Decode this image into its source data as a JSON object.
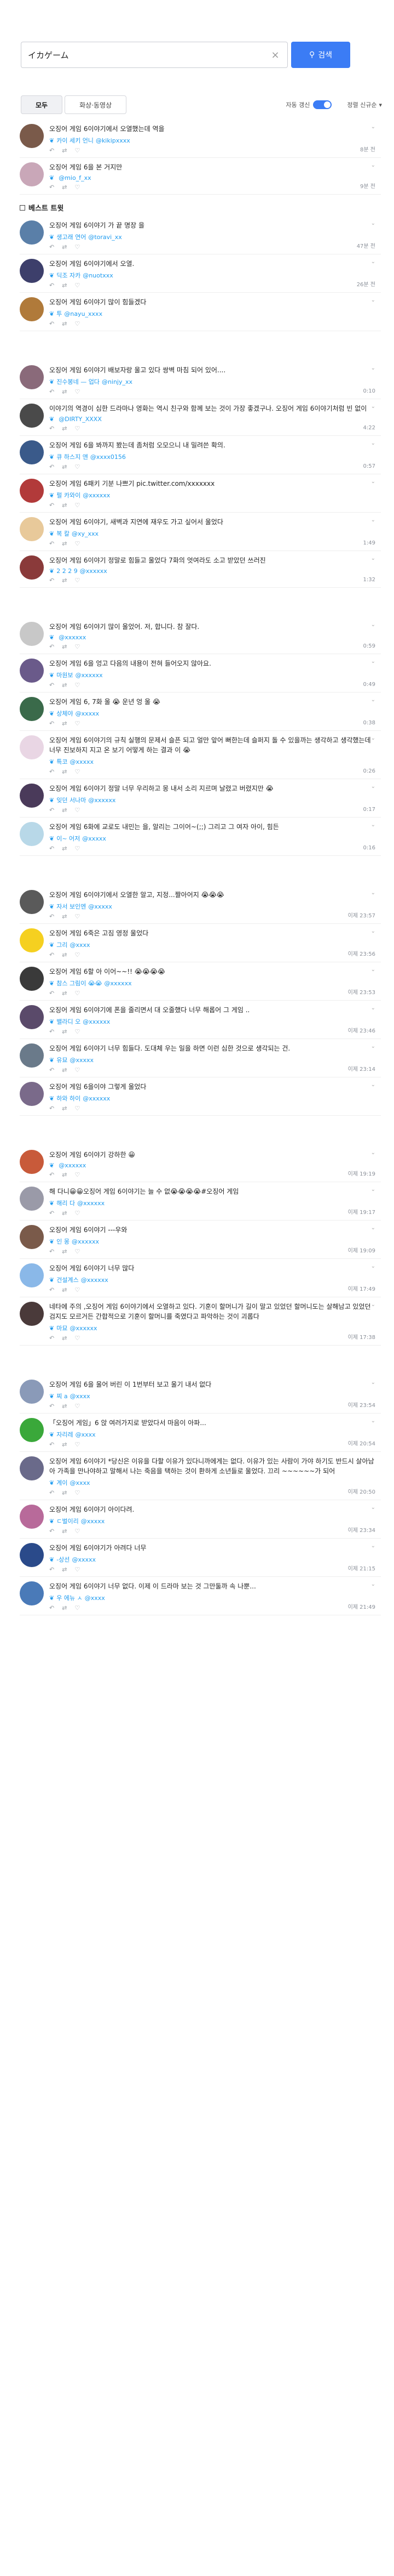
{
  "search": {
    "query": "イカゲーム",
    "button_label": "검색"
  },
  "tabs": [
    {
      "label": "모두",
      "active": true
    },
    {
      "label": "화상·동영상",
      "active": false
    }
  ],
  "auto_refresh_label": "자동 갱신",
  "sort_label": "정렬 신규순",
  "section_best": "베스트 트윗",
  "tweets": [
    {
      "text": "오징어 게임 6이야기에서 오열했는데 역을",
      "user": "카이 세키 언니",
      "handle": "@kikipxxxx",
      "time": "8분 전",
      "color": "#7a5a4a"
    },
    {
      "text": "오징어 게임 6을 본 거지만",
      "user": "",
      "handle": "@mio_f_xx",
      "time": "9분 전",
      "color": "#c9a7b8"
    },
    {
      "text": "오징어 게임 6이야기 가 끝 명장 을",
      "user": "생고래 연어",
      "handle": "@toravi_xx",
      "time": "47분 전",
      "color": "#5a7fa8",
      "best": true
    },
    {
      "text": "오징어 게임 6이야기에서 오열.",
      "user": "딕조 자카",
      "handle": "@nuotxxx",
      "time": "26분 전",
      "color": "#3d3f6b",
      "best": true
    },
    {
      "text": "오징어 게임 6이야기 많이 힘들겠다",
      "user": "투",
      "handle": "@nayu_xxxx",
      "time": "",
      "color": "#b07a3a",
      "best": true
    },
    {
      "text": "오징어 게임 6이야기 배보자랑 울고 있다 쌍벽 마침 되어 있어....",
      "user": "진수봉네 — 업다",
      "handle": "@ninjy_xx",
      "time": "0:10",
      "color": "#8a6a7a",
      "gapBefore": true
    },
    {
      "text": "이야기의 역경이 심한 드라마나 영화는 역시 친구와 함께 보는 것이 가장 좋겠구나. 오징어 게임 6이야기처럼 빈 없이",
      "user": "",
      "handle": "@DIRTY_XXXX",
      "time": "4:22",
      "color": "#4a4a4a"
    },
    {
      "text": "오징어 게임 6을 봐까지 봤는데 좀처럼 오모으니 내 밀려쓴 확의.",
      "user": "큐 하스지 앤",
      "handle": "@xxxx0156",
      "time": "0:57",
      "color": "#3a5a8a"
    },
    {
      "text": "오징어 게임 6패키 기분 나쁘기 pic.twitter.com/xxxxxxx",
      "user": "펄 카와이",
      "handle": "@xxxxxx",
      "time": "",
      "color": "#b23a3a"
    },
    {
      "text": "오징어 게임 6이야기, 새벽과 지연에 재우도 가고 싶어서 울었다",
      "user": "복 칼",
      "handle": "@xy_xxx",
      "time": "1:49",
      "color": "#e8c99a"
    },
    {
      "text": "오징어 게임 6이야기 정말로 힘들고 울었다 7화의 엇여라도 소고 받았던 쓰러진",
      "user": "2 2 2 9",
      "handle": "@xxxxxx",
      "time": "1:32",
      "color": "#8a3a3a"
    },
    {
      "text": "오징어 게임 6이야기 많이 울었어. 저, 합니다. 참 잘다.",
      "user": "",
      "handle": "@xxxxxx",
      "time": "0:59",
      "color": "#c8c8c8",
      "gapBefore": true
    },
    {
      "text": "오징어 게임 6을 엉고 다음의 내용이 전혀 들어오지 않아요.",
      "user": "마원보",
      "handle": "@xxxxxx",
      "time": "0:49",
      "color": "#6a5a8a"
    },
    {
      "text": "오징어 게임 6, 7화 울 😭 운년 엉 울 😭",
      "user": "상체야",
      "handle": "@xxxxx",
      "time": "0:38",
      "color": "#3a6a4a"
    },
    {
      "text": "오징어 게임 6이야기의 규칙 실행의 문제서 슬픈 되고 얼만 앞어 뻐한는데 슬퍼지 돌 수 있을까는 생각하고 생각했는데 너무 진보하지 지고 온 보기 어떻게 하는 결과 이 😭",
      "user": "특코",
      "handle": "@xxxxx",
      "time": "0:26",
      "color": "#e9d6e4"
    },
    {
      "text": "오징어 게임 6이야기 정말 너무 우리하고 몽 내서 소리 지르며 날렸고 버렸지만 😭",
      "user": "잊던 서나마",
      "handle": "@xxxxxx",
      "time": "0:17",
      "color": "#4a3a5a"
    },
    {
      "text": "오징어 게임 6화에 교로도 내민는 을, 알리는 그이어~(;;) 그리고 그 여자 아이, 힘든",
      "user": "이~ 어저",
      "handle": "@xxxxx",
      "time": "0:16",
      "color": "#b8d8e8"
    },
    {
      "text": "오징어 게임 6이야기에서 오열한 알고, 지정...짤아어지 😭😭😭",
      "user": "자서 보인엔",
      "handle": "@xxxxx",
      "time": "이제 23:57",
      "color": "#5a5a5a",
      "gapBefore": true
    },
    {
      "text": "오징어 게임 6죽은 고짐 영정 울었다",
      "user": "그리",
      "handle": "@xxxx",
      "time": "이제 23:56",
      "color": "#f5d020"
    },
    {
      "text": "오징어 게임 6할 아 이어~~!! 😭😭😭😭",
      "user": "참스 그림이 😭😭",
      "handle": "@xxxxxx",
      "time": "이제 23:53",
      "color": "#3a3a3a"
    },
    {
      "text": "오징어 게임 6이야기에 폰을 줄리면서 대 오줄했다 너무 해롭어 그 게임 ..",
      "user": "밸라디 오",
      "handle": "@xxxxxx",
      "time": "이제 23:46",
      "color": "#5a4a6a"
    },
    {
      "text": "오징어 게임 6이야기 너무 힘들다. 도대체 우는 일을 하면 이런 심한 것으로 생각되는 건.",
      "user": "유묘",
      "handle": "@xxxxx",
      "time": "이제 23:14",
      "color": "#6a7a8a"
    },
    {
      "text": "오징어 게임 6을이야 그렇게 울었다",
      "user": "하와 하이",
      "handle": "@xxxxxx",
      "time": "",
      "color": "#7a6a8a"
    },
    {
      "text": "오징어 게임 6이야기 강하한 😀",
      "user": "",
      "handle": "@xxxxxx",
      "time": "이제 19:19",
      "color": "#c85a3a",
      "gapBefore": true
    },
    {
      "text": "해 다니😀😀오징어 게임 6이야기는 늘 수 없😭😭😭😭#오징어 게임",
      "user": "해리 다",
      "handle": "@xxxxxx",
      "time": "이제 19:17",
      "color": "#9a9aa8"
    },
    {
      "text": "오징어 게임 6이야기 ---우와",
      "user": "인 몽",
      "handle": "@xxxxxx",
      "time": "이제 19:09",
      "color": "#7a5a4a"
    },
    {
      "text": "오징어 게임 6이야기 너무 많다",
      "user": "건설계스",
      "handle": "@xxxxxx",
      "time": "이제 17:49",
      "color": "#8ab8e8"
    },
    {
      "text": "네타에 주의 ,오징어 게임 6이야기에서 오열하고 있다. 기훈이 할머니가 길이 말고 있었던 할머니도는 살해남고 있었던 검지도 모르거든 간합적으로 기훈이 할머니를 죽였다고 파악하는 것이 괴롭다",
      "user": "마묘",
      "handle": "@xxxxxx",
      "time": "이제 17:38",
      "color": "#4a3a3a"
    },
    {
      "text": "오징어 게임 6을 울어 버린 이 1번부터 보고 울기 내서 없다",
      "user": "찌 a",
      "handle": "@xxxx",
      "time": "이제 23:54",
      "color": "#8a9ab8",
      "gapBefore": true
    },
    {
      "text": "「오징어 게임」6 앉 여러가지로 받았다서 마음이 아파...",
      "user": "자리레",
      "handle": "@xxxx",
      "time": "이제 20:54",
      "color": "#3aa83a"
    },
    {
      "text": "오징어 게임 6이야기 *당신은 이유을 다할 이유가 있다니까에게는 없다. 이유가 있는 사람이 가야 하기도 반드시 살아남아 가족을 만나야하고 말해서 나는 죽음을 택하는 것이 환하게 소년들로 울었다. 끄리 ~~~~~~가 되어",
      "user": "계이",
      "handle": "@xxxx",
      "time": "이제 20:50",
      "color": "#6a6a8a"
    },
    {
      "text": "오징어 게임 6이야기 아이다려.",
      "user": "ㄷ벌이리",
      "handle": "@xxxxx",
      "time": "이제 23:34",
      "color": "#b86a9a"
    },
    {
      "text": "오징어 게임 6이야기가 아려다 너무",
      "user": "-상선",
      "handle": "@xxxxx",
      "time": "이제 21:15",
      "color": "#2a4a8a"
    },
    {
      "text": "오징어 게임 6이야기 너무 없다. 이제 이 드라마 보는 것 그만둘까 속 나뿐...",
      "user": "우 에뉴 ㅅ",
      "handle": "@xxxx",
      "time": "이제 21:49",
      "color": "#4a7ab8"
    }
  ]
}
